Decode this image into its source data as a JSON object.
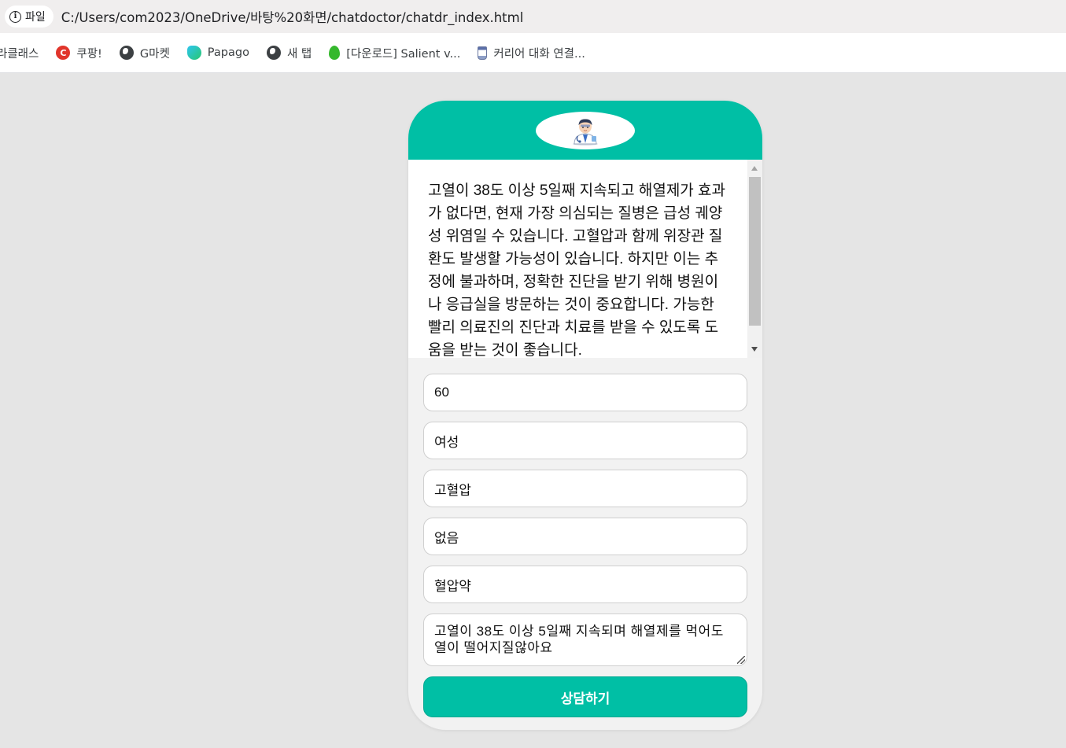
{
  "browser": {
    "site_chip_label": "파일",
    "url": "C:/Users/com2023/OneDrive/바탕%20화면/chatdoctor/chatdr_index.html",
    "bookmarks": [
      {
        "label": "라클래스",
        "icon": "none"
      },
      {
        "label": "쿠팡!",
        "icon": "coupang-icon"
      },
      {
        "label": "G마켓",
        "icon": "globe-icon"
      },
      {
        "label": "Papago",
        "icon": "papago-icon"
      },
      {
        "label": "새 탭",
        "icon": "globe-icon"
      },
      {
        "label": "[다운로드] Salient v...",
        "icon": "green-drop-icon"
      },
      {
        "label": "커리어 대화 연결...",
        "icon": "cup-icon"
      }
    ]
  },
  "chat": {
    "answer": "고열이 38도 이상 5일째 지속되고 해열제가 효과가 없다면, 현재 가장 의심되는 질병은 급성 궤양성 위염일 수 있습니다. 고혈압과 함께 위장관 질환도 발생할 가능성이 있습니다. 하지만 이는 추정에 불과하며, 정확한 진단을 받기 위해 병원이나 응급실을 방문하는 것이 중요합니다. 가능한 빨리 의료진의 진단과 치료를 받을 수 있도록 도움을 받는 것이 좋습니다.",
    "fields": {
      "age": "60",
      "gender": "여성",
      "disease": "고혈압",
      "allergy": "없음",
      "medication": "혈압약"
    },
    "symptom_text": "고열이 38도 이상 5일째 지속되며 해열제를 먹어도 열이 떨어지질않아요",
    "submit_label": "상담하기"
  },
  "colors": {
    "accent": "#00bfa5",
    "page_bg": "#e5e5e5"
  }
}
